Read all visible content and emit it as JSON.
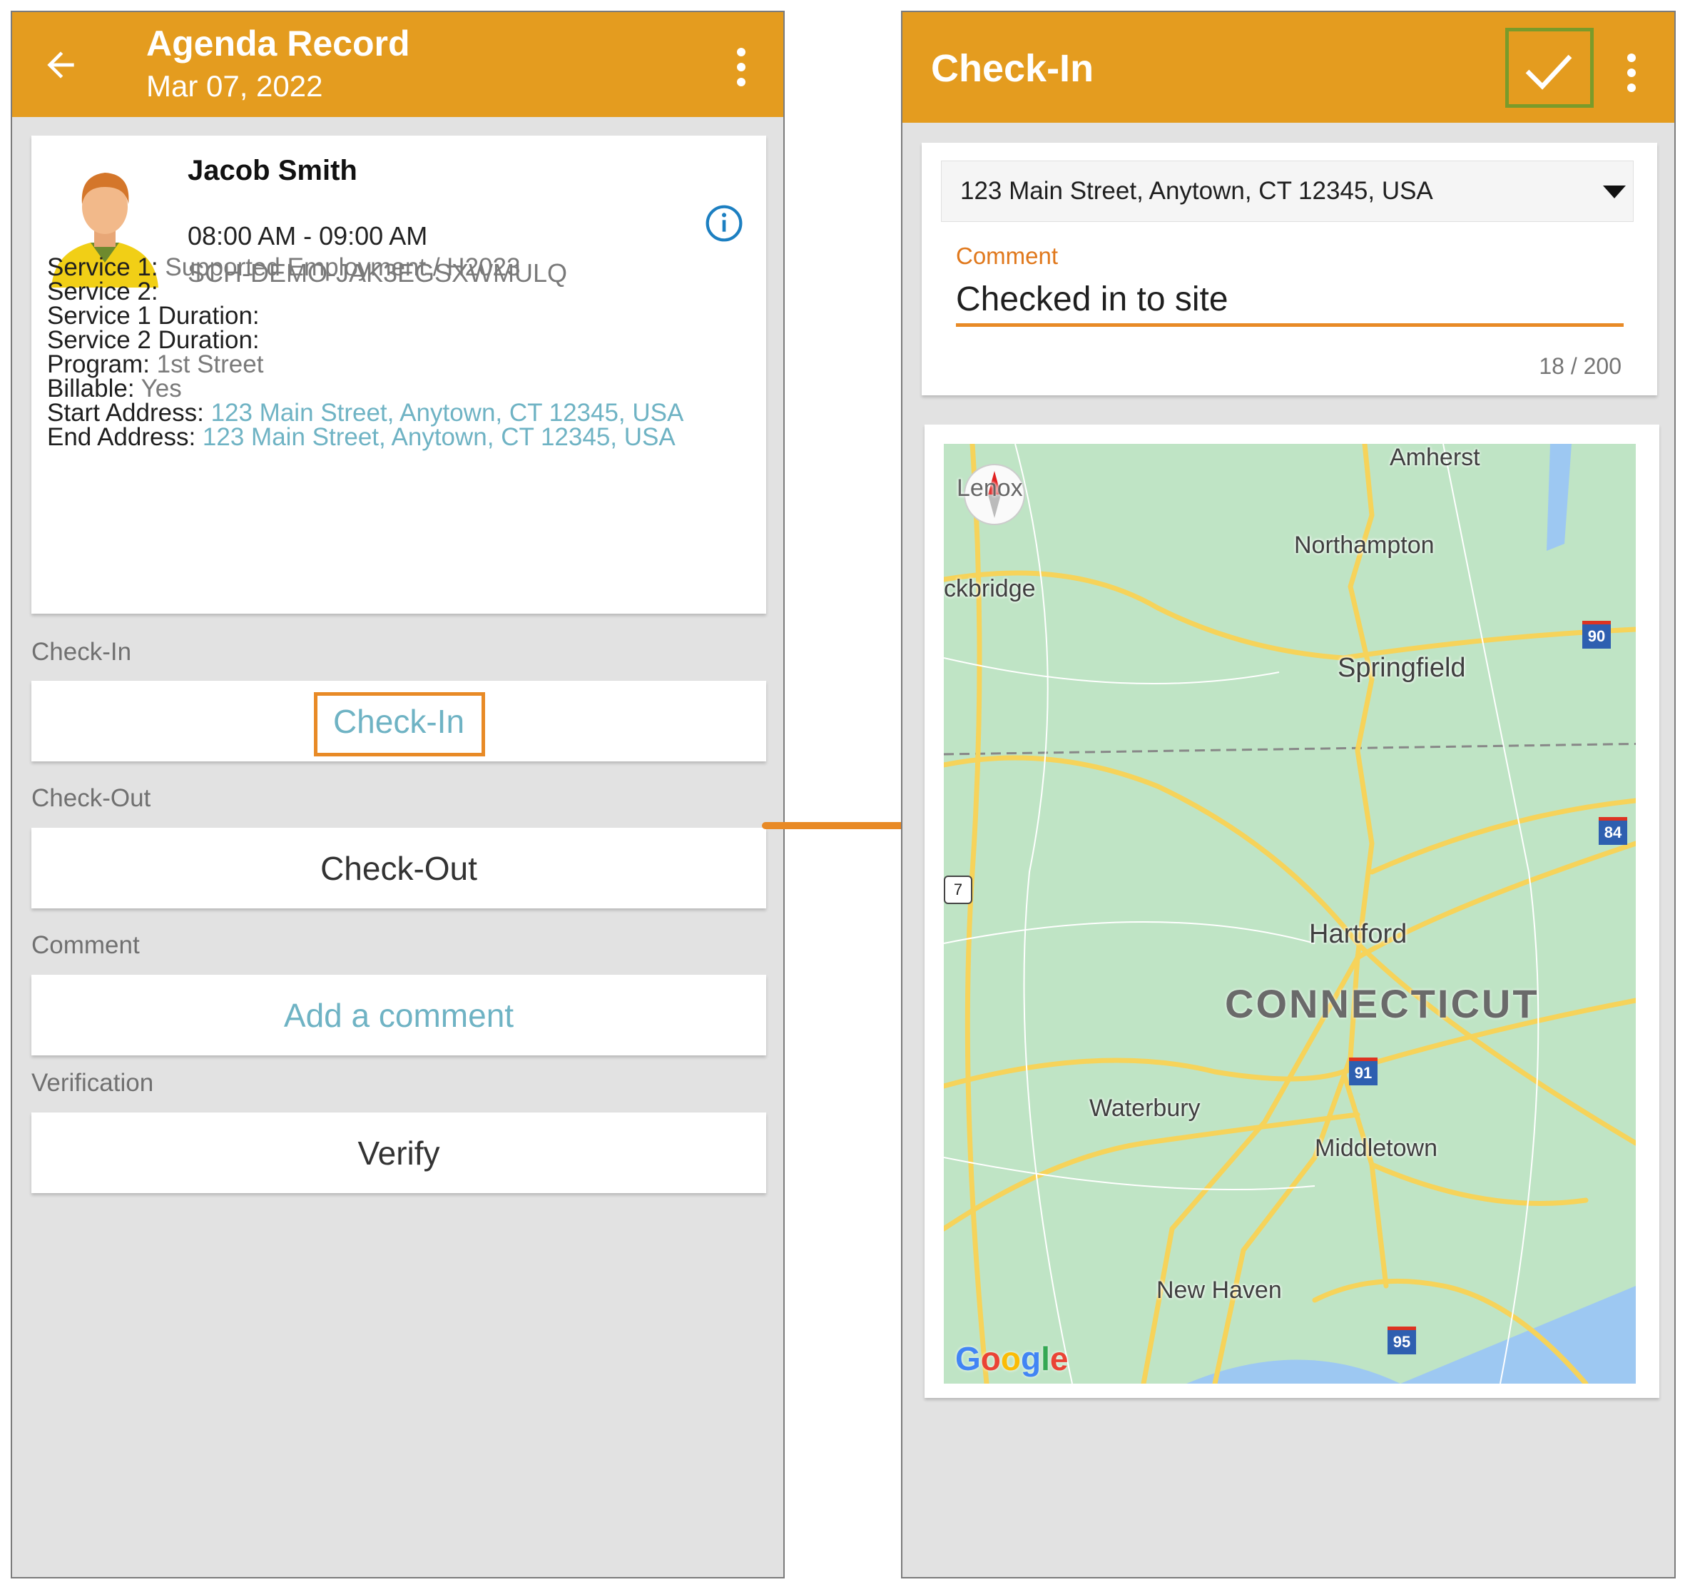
{
  "left_screen": {
    "title": "Agenda Record",
    "date": "Mar 07, 2022",
    "client": {
      "name": "Jacob Smith",
      "time": "08:00 AM - 09:00 AM",
      "schedule_id": "SCH-DEMO-JAK3EGSXWMULQ"
    },
    "details": [
      {
        "label": "Service 1: ",
        "value": "Supported Employment / H2023",
        "style": "v"
      },
      {
        "label": "Service 2:",
        "value": "",
        "style": "v"
      },
      {
        "label": "Service 1 Duration:",
        "value": "",
        "style": "v"
      },
      {
        "label": "Service 2 Duration:",
        "value": "",
        "style": "v"
      },
      {
        "label": "Program: ",
        "value": "1st Street",
        "style": "v"
      },
      {
        "label": "Billable: ",
        "value": "Yes",
        "style": "v"
      },
      {
        "label": "Start Address: ",
        "value": "123 Main Street, Anytown, CT 12345, USA",
        "style": "a"
      },
      {
        "label": "End Address: ",
        "value": "123 Main Street, Anytown, CT 12345, USA",
        "style": "a"
      }
    ],
    "sections": {
      "checkin_label": "Check-In",
      "checkin_button": "Check-In",
      "checkout_label": "Check-Out",
      "checkout_button": "Check-Out",
      "comment_label": "Comment",
      "comment_button": "Add a comment",
      "verification_label": "Verification",
      "verify_button": "Verify"
    }
  },
  "right_screen": {
    "title": "Check-In",
    "address_select": "123 Main Street, Anytown, CT 12345, USA",
    "comment_label": "Comment",
    "comment_value": "Checked in to site",
    "char_count": "18 / 200",
    "map": {
      "state_label": "CONNECTICUT",
      "cities": [
        "Amherst",
        "Lenox",
        "ckbridge",
        "Northampton",
        "Springfield",
        "Hartford",
        "Waterbury",
        "Middletown",
        "New Haven"
      ],
      "highways": [
        "90",
        "84",
        "91",
        "95",
        "7"
      ],
      "attribution": "Google"
    }
  },
  "colors": {
    "appbar": "#e49c1f",
    "accent": "#e88a26",
    "link": "#6fb3c4",
    "confirm_highlight": "#7a9b2a"
  }
}
